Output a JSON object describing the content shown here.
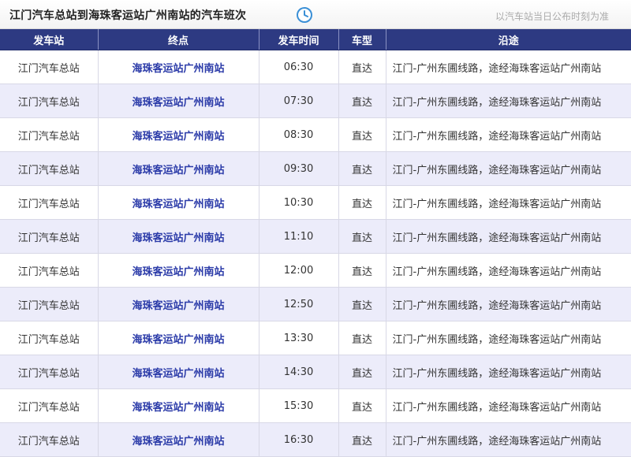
{
  "header": {
    "title": "江门汽车总站到海珠客运站广州南站的汽车班次",
    "note": "以汽车站当日公布时刻为准",
    "clock_icon": "clock-icon"
  },
  "colors": {
    "header_bg": "#2d3a82",
    "row_alt": "#ececfa",
    "link": "#2a3aa8",
    "clock": "#3a8fd6"
  },
  "table": {
    "columns": [
      "发车站",
      "终点",
      "发车时间",
      "车型",
      "沿途"
    ],
    "rows": [
      {
        "station": "江门汽车总站",
        "dest": "海珠客运站广州南站",
        "time": "06:30",
        "type": "直达",
        "route": "江门-广州东圃线路，途经海珠客运站广州南站"
      },
      {
        "station": "江门汽车总站",
        "dest": "海珠客运站广州南站",
        "time": "07:30",
        "type": "直达",
        "route": "江门-广州东圃线路，途经海珠客运站广州南站"
      },
      {
        "station": "江门汽车总站",
        "dest": "海珠客运站广州南站",
        "time": "08:30",
        "type": "直达",
        "route": "江门-广州东圃线路，途经海珠客运站广州南站"
      },
      {
        "station": "江门汽车总站",
        "dest": "海珠客运站广州南站",
        "time": "09:30",
        "type": "直达",
        "route": "江门-广州东圃线路，途经海珠客运站广州南站"
      },
      {
        "station": "江门汽车总站",
        "dest": "海珠客运站广州南站",
        "time": "10:30",
        "type": "直达",
        "route": "江门-广州东圃线路，途经海珠客运站广州南站"
      },
      {
        "station": "江门汽车总站",
        "dest": "海珠客运站广州南站",
        "time": "11:10",
        "type": "直达",
        "route": "江门-广州东圃线路，途经海珠客运站广州南站"
      },
      {
        "station": "江门汽车总站",
        "dest": "海珠客运站广州南站",
        "time": "12:00",
        "type": "直达",
        "route": "江门-广州东圃线路，途经海珠客运站广州南站"
      },
      {
        "station": "江门汽车总站",
        "dest": "海珠客运站广州南站",
        "time": "12:50",
        "type": "直达",
        "route": "江门-广州东圃线路，途经海珠客运站广州南站"
      },
      {
        "station": "江门汽车总站",
        "dest": "海珠客运站广州南站",
        "time": "13:30",
        "type": "直达",
        "route": "江门-广州东圃线路，途经海珠客运站广州南站"
      },
      {
        "station": "江门汽车总站",
        "dest": "海珠客运站广州南站",
        "time": "14:30",
        "type": "直达",
        "route": "江门-广州东圃线路，途经海珠客运站广州南站"
      },
      {
        "station": "江门汽车总站",
        "dest": "海珠客运站广州南站",
        "time": "15:30",
        "type": "直达",
        "route": "江门-广州东圃线路，途经海珠客运站广州南站"
      },
      {
        "station": "江门汽车总站",
        "dest": "海珠客运站广州南站",
        "time": "16:30",
        "type": "直达",
        "route": "江门-广州东圃线路，途经海珠客运站广州南站"
      }
    ]
  }
}
